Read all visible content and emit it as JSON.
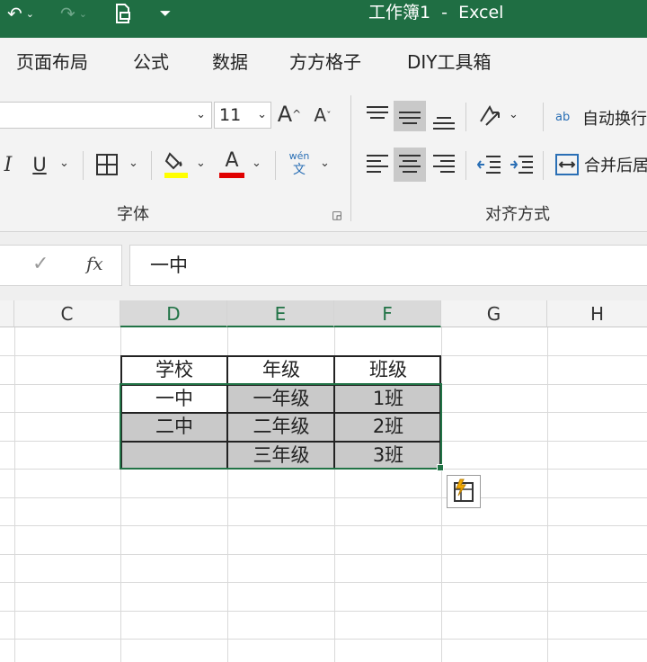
{
  "titlebar": {
    "title": "工作簿1  -  Excel",
    "bg_color": "#1f6e43"
  },
  "ribbon_tabs": [
    "页面布局",
    "公式",
    "数据",
    "方方格子",
    "DIY工具箱"
  ],
  "font_group": {
    "font_size": "11",
    "label": "字体",
    "phonetic_top": "wén",
    "phonetic_bottom": "文",
    "grow_font": "A",
    "shrink_font": "A",
    "italic": "I",
    "underline": "U",
    "font_color_letter": "A"
  },
  "align_group": {
    "label": "对齐方式",
    "wrap_text": "自动换行",
    "merge_center": "合并后居",
    "wrap_icon_text": "ab"
  },
  "formula_bar": {
    "value": "一中",
    "fx": "fx",
    "check": "✓"
  },
  "columns": [
    "C",
    "D",
    "E",
    "F",
    "G",
    "H"
  ],
  "table": {
    "headers": [
      "学校",
      "年级",
      "班级"
    ],
    "rows": [
      [
        "一中",
        "一年级",
        "1班"
      ],
      [
        "二中",
        "二年级",
        "2班"
      ],
      [
        "",
        "三年级",
        "3班"
      ]
    ]
  },
  "colors": {
    "accent": "#217346",
    "highlight": "#c9c9c9",
    "fill_color_bar": "#ffff00",
    "font_color_bar": "#e00000"
  }
}
